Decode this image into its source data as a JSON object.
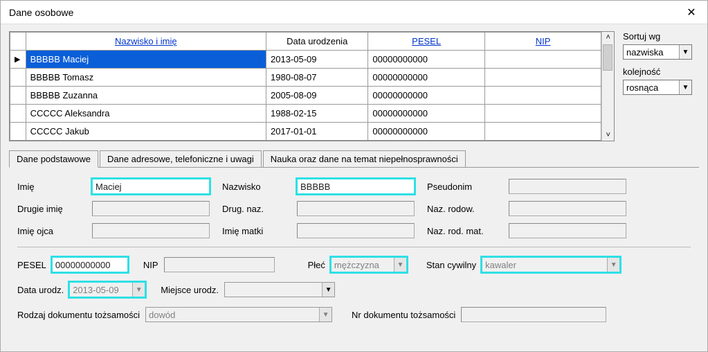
{
  "window": {
    "title": "Dane osobowe"
  },
  "grid": {
    "headers": {
      "indicator": "",
      "name": "Nazwisko i imię",
      "dob": "Data urodzenia",
      "pesel": "PESEL",
      "nip": "NIP"
    },
    "rows": [
      {
        "indicator": "▶",
        "name": "BBBBB Maciej",
        "dob": "2013-05-09",
        "pesel": "00000000000",
        "nip": "",
        "selected": true
      },
      {
        "indicator": "",
        "name": "BBBBB Tomasz",
        "dob": "1980-08-07",
        "pesel": "00000000000",
        "nip": "",
        "selected": false
      },
      {
        "indicator": "",
        "name": "BBBBB Zuzanna",
        "dob": "2005-08-09",
        "pesel": "00000000000",
        "nip": "",
        "selected": false
      },
      {
        "indicator": "",
        "name": "CCCCC Aleksandra",
        "dob": "1988-02-15",
        "pesel": "00000000000",
        "nip": "",
        "selected": false
      },
      {
        "indicator": "",
        "name": "CCCCC Jakub",
        "dob": "2017-01-01",
        "pesel": "00000000000",
        "nip": "",
        "selected": false
      }
    ]
  },
  "sort": {
    "label1": "Sortuj wg",
    "value1": "nazwiska",
    "label2": "kolejność",
    "value2": "rosnąca"
  },
  "tabs": {
    "t0": "Dane podstawowe",
    "t1": "Dane adresowe, telefoniczne i uwagi",
    "t2": "Nauka oraz dane na temat niepełnosprawności"
  },
  "form": {
    "labels": {
      "imie": "Imię",
      "nazwisko": "Nazwisko",
      "pseudonim": "Pseudonim",
      "drugie_imie": "Drugie imię",
      "drug_naz": "Drug. naz.",
      "naz_rodow": "Naz. rodow.",
      "imie_ojca": "Imię ojca",
      "imie_matki": "Imię matki",
      "naz_rod_mat": "Naz. rod. mat.",
      "pesel": "PESEL",
      "nip": "NIP",
      "plec": "Płeć",
      "stan": "Stan cywilny",
      "data_urodz": "Data urodz.",
      "miejsce_urodz": "Miejsce urodz.",
      "rodzaj_doc": "Rodzaj dokumentu tożsamości",
      "nr_doc": "Nr dokumentu tożsamości"
    },
    "values": {
      "imie": "Maciej",
      "nazwisko": "BBBBB",
      "pseudonim": "",
      "drugie_imie": "",
      "drug_naz": "",
      "naz_rodow": "",
      "imie_ojca": "",
      "imie_matki": "",
      "naz_rod_mat": "",
      "pesel": "00000000000",
      "nip": "",
      "plec": "mężczyzna",
      "stan": "kawaler",
      "data_urodz": "2013-05-09",
      "miejsce_urodz": "",
      "rodzaj_doc": "dowód",
      "nr_doc": ""
    }
  }
}
